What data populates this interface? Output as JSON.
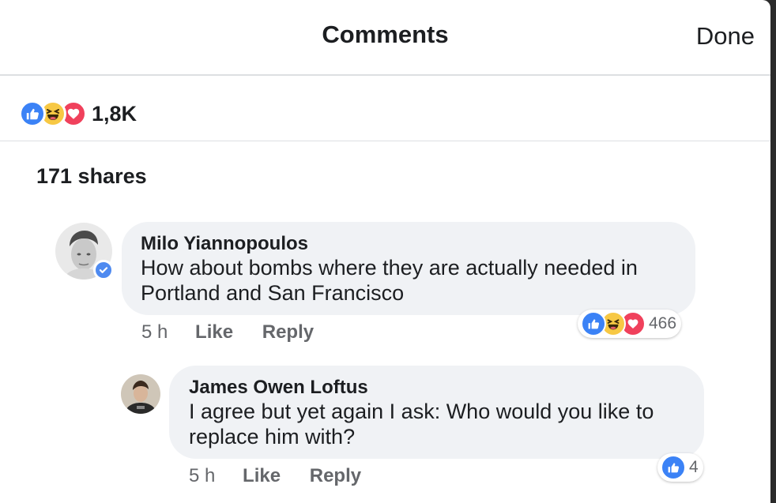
{
  "header": {
    "title": "Comments",
    "done_label": "Done"
  },
  "post_reactions": {
    "icons": [
      "like-icon",
      "haha-icon",
      "love-icon"
    ],
    "count": "1,8K"
  },
  "shares_label": "171 shares",
  "comments": [
    {
      "author": "Milo Yiannopoulos",
      "verified": true,
      "text_line1": "How about bombs where they are actually needed in",
      "text_line2": "Portland and San Francisco",
      "time": "5 h",
      "like_label": "Like",
      "reply_label": "Reply",
      "reaction_icons": [
        "like-icon",
        "haha-icon",
        "love-icon"
      ],
      "reaction_count": "466"
    },
    {
      "author": "James Owen Loftus",
      "verified": false,
      "text_line1": "I agree but yet again I ask: Who would you like to",
      "text_line2": "replace him with?",
      "time": "5 h",
      "like_label": "Like",
      "reply_label": "Reply",
      "reaction_icons": [
        "like-icon"
      ],
      "reaction_count": "4"
    }
  ],
  "colors": {
    "like": "#3b82f6",
    "haha": "#f7c844",
    "love": "#f0415c",
    "bubble": "#f0f2f5",
    "verified": "#4e8af0"
  }
}
